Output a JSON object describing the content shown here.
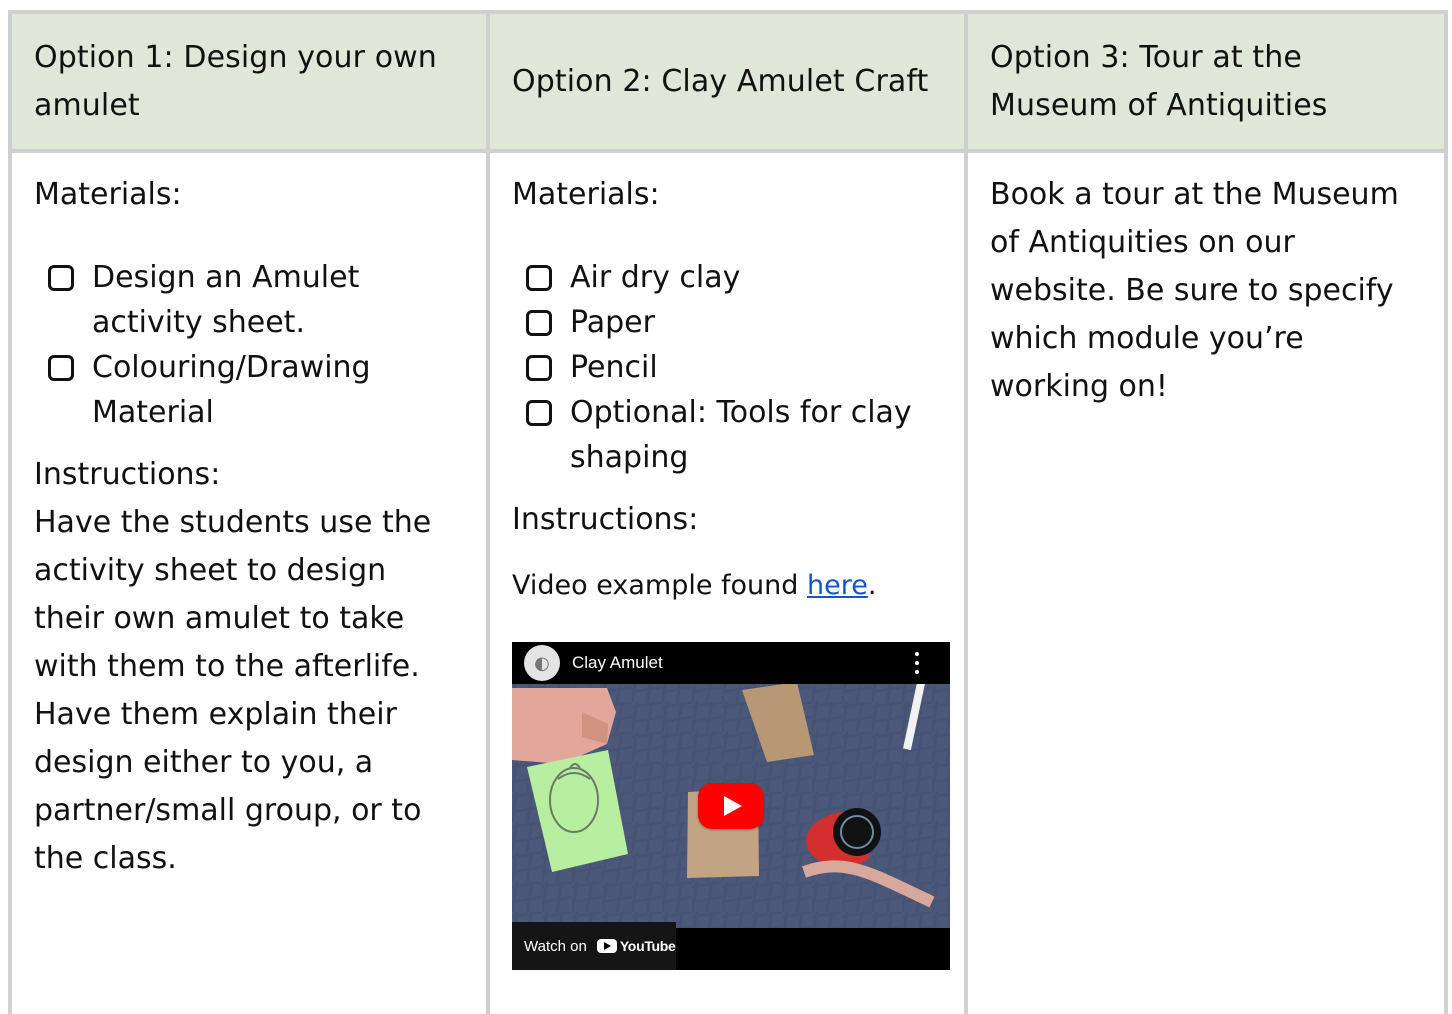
{
  "headers": {
    "option1": "Option 1: Design your own amulet",
    "option2": "Option 2: Clay Amulet Craft",
    "option3": "Option 3: Tour at the Museum of Antiquities"
  },
  "col1": {
    "materials_label": "Materials:",
    "materials": [
      "Design an Amulet activity sheet.",
      "Colouring/Drawing Material"
    ],
    "instructions_label": "Instructions:",
    "instructions": "Have the students use the activity sheet to design their own amulet to take with them to the afterlife. Have them explain their design either to you, a partner/small group, or to the class."
  },
  "col2": {
    "materials_label": "Materials:",
    "materials": [
      "Air dry clay",
      "Paper",
      "Pencil",
      "Optional: Tools for clay shaping"
    ],
    "instructions_label": "Instructions:",
    "video_text_prefix": "Video example found ",
    "video_link_text": "here",
    "video_text_suffix": ".",
    "video": {
      "title": "Clay Amulet",
      "watch_on": "Watch on",
      "brand": "YouTube"
    }
  },
  "col3": {
    "text": "Book a tour at the Museum of Antiquities on our website. Be sure to specify which module you’re working on!"
  },
  "colors": {
    "header_bg": "#dfe7d8",
    "border": "#cfcfcf",
    "link": "#1155cc",
    "play_red": "#ff0000"
  }
}
